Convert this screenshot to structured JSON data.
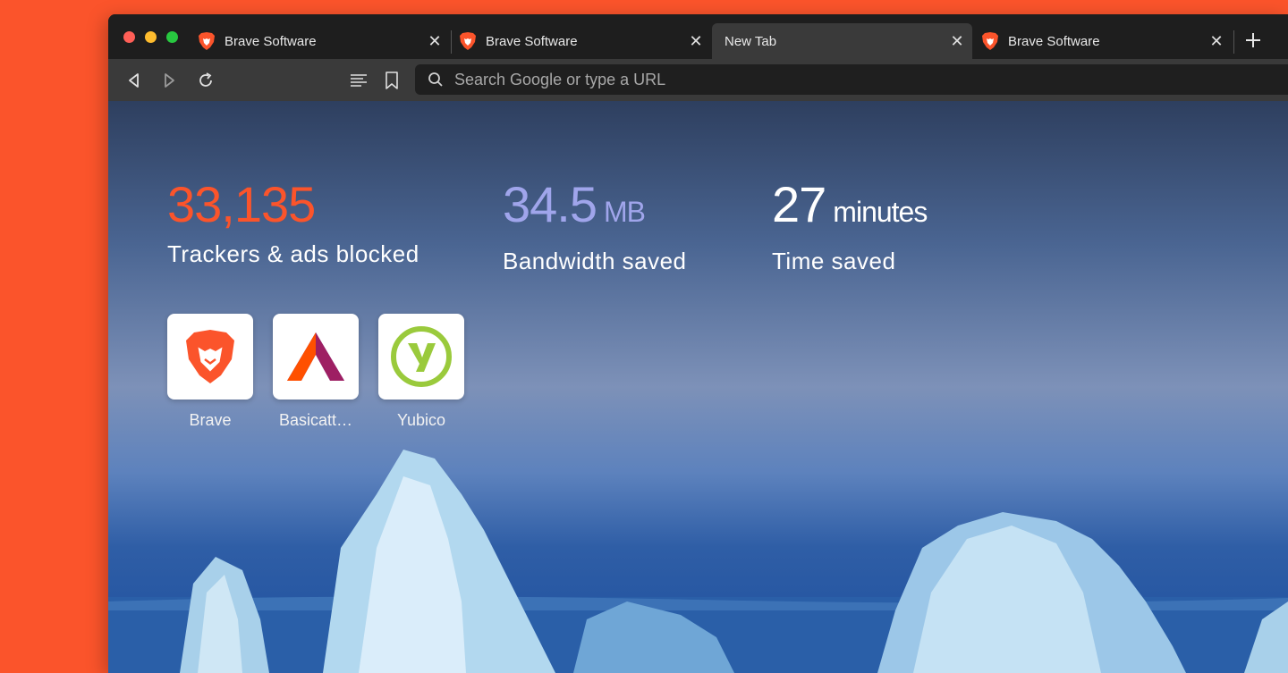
{
  "colors": {
    "background": "#fb542b",
    "trackers": "#fb542b",
    "bandwidth": "#a0a5eb",
    "time": "#ffffff",
    "tab_strip": "#1e1e1e",
    "toolbar": "#3a3a3a"
  },
  "tabs": [
    {
      "title": "Brave Software",
      "icon": "brave-lion-icon",
      "active": false
    },
    {
      "title": "Brave Software",
      "icon": "brave-lion-icon",
      "active": false
    },
    {
      "title": "New Tab",
      "icon": "",
      "active": true
    },
    {
      "title": "Brave Software",
      "icon": "brave-lion-icon",
      "active": false
    }
  ],
  "toolbar": {
    "search_placeholder": "Search Google or type a URL",
    "buttons": [
      "back-icon",
      "forward-icon",
      "reload-icon",
      "reader-list-icon",
      "bookmark-icon"
    ]
  },
  "stats": {
    "trackers": {
      "value": "33,135",
      "label": "Trackers & ads blocked"
    },
    "bandwidth": {
      "value": "34.5",
      "unit": "MB",
      "label": "Bandwidth saved"
    },
    "time": {
      "value": "27",
      "unit": "minutes",
      "label": "Time saved"
    }
  },
  "top_sites": [
    {
      "name": "Brave",
      "icon": "brave-lion-icon"
    },
    {
      "name": "Basicatt…",
      "icon": "bat-triangle-icon"
    },
    {
      "name": "Yubico",
      "icon": "yubico-icon"
    }
  ]
}
